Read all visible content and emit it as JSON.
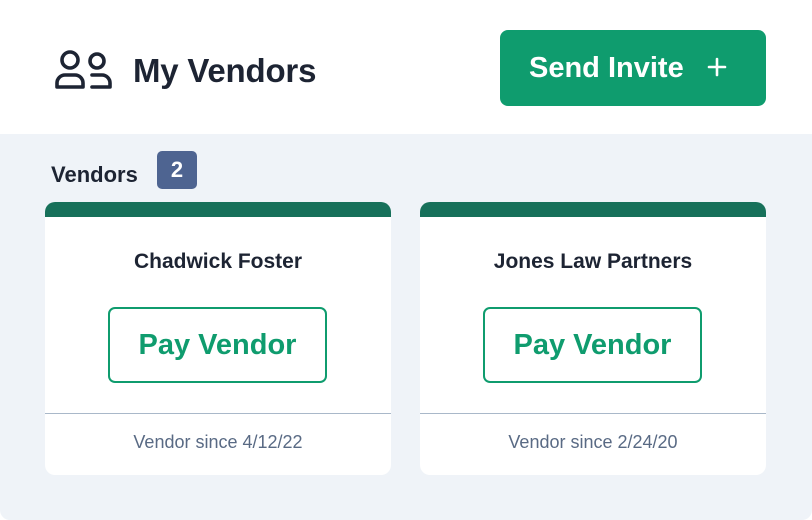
{
  "header": {
    "title": "My Vendors",
    "icon": "users-icon",
    "invite_button": {
      "label": "Send Invite",
      "icon": "plus-icon"
    }
  },
  "vendors_section": {
    "label": "Vendors",
    "count": "2",
    "cards": [
      {
        "name": "Chadwick Foster",
        "pay_label": "Pay Vendor",
        "since": "Vendor since 4/12/22"
      },
      {
        "name": "Jones Law Partners",
        "pay_label": "Pay Vendor",
        "since": "Vendor since 2/24/20"
      }
    ]
  },
  "colors": {
    "accent": "#0f9c6e",
    "card_bar": "#17705a",
    "badge": "#4e6491",
    "background": "#eff3f8",
    "text": "#1d2433"
  }
}
